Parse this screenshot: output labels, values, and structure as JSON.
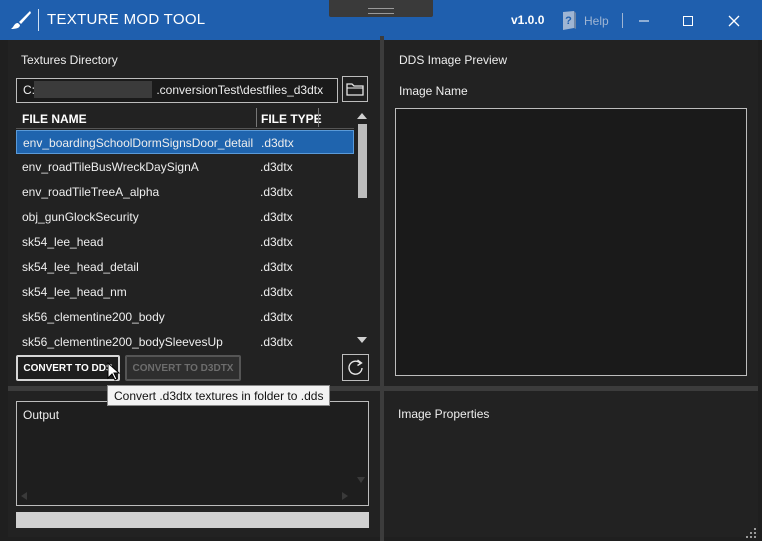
{
  "window": {
    "title": "TEXTURE MOD TOOL",
    "version": "v1.0.0",
    "help_label": "Help"
  },
  "colors": {
    "titlebar": "#1f5fae",
    "selection": "#1f64ae",
    "panel": "#222222"
  },
  "icons": {
    "app": "paintbrush-icon",
    "help": "help-book-icon",
    "folder": "folder-icon",
    "refresh": "refresh-icon",
    "minimize": "minimize-icon",
    "maximize": "maximize-icon",
    "close": "close-icon"
  },
  "left": {
    "textures_directory_label": "Textures Directory",
    "path_prefix": "C:\\",
    "path_suffix": ".conversionTest\\destfiles_d3dtx",
    "columns": [
      "FILE NAME",
      "FILE TYPE"
    ],
    "files": [
      {
        "name": "env_boardingSchoolDormSignsDoor_detail",
        "type": ".d3dtx",
        "selected": true
      },
      {
        "name": "env_roadTileBusWreckDaySignA",
        "type": ".d3dtx"
      },
      {
        "name": "env_roadTileTreeA_alpha",
        "type": ".d3dtx"
      },
      {
        "name": "obj_gunGlockSecurity",
        "type": ".d3dtx"
      },
      {
        "name": "sk54_lee_head",
        "type": ".d3dtx"
      },
      {
        "name": "sk54_lee_head_detail",
        "type": ".d3dtx"
      },
      {
        "name": "sk54_lee_head_nm",
        "type": ".d3dtx"
      },
      {
        "name": "sk56_clementine200_body",
        "type": ".d3dtx"
      },
      {
        "name": "sk56_clementine200_bodySleevesUp",
        "type": ".d3dtx"
      }
    ],
    "convert_to_dds": "CONVERT TO DDS",
    "convert_to_d3dtx": "CONVERT TO D3DTX",
    "tooltip": "Convert .d3dtx textures in folder to .dds",
    "output_label": "Output"
  },
  "right": {
    "preview_label": "DDS Image Preview",
    "image_name_label": "Image Name",
    "properties_label": "Image Properties"
  }
}
